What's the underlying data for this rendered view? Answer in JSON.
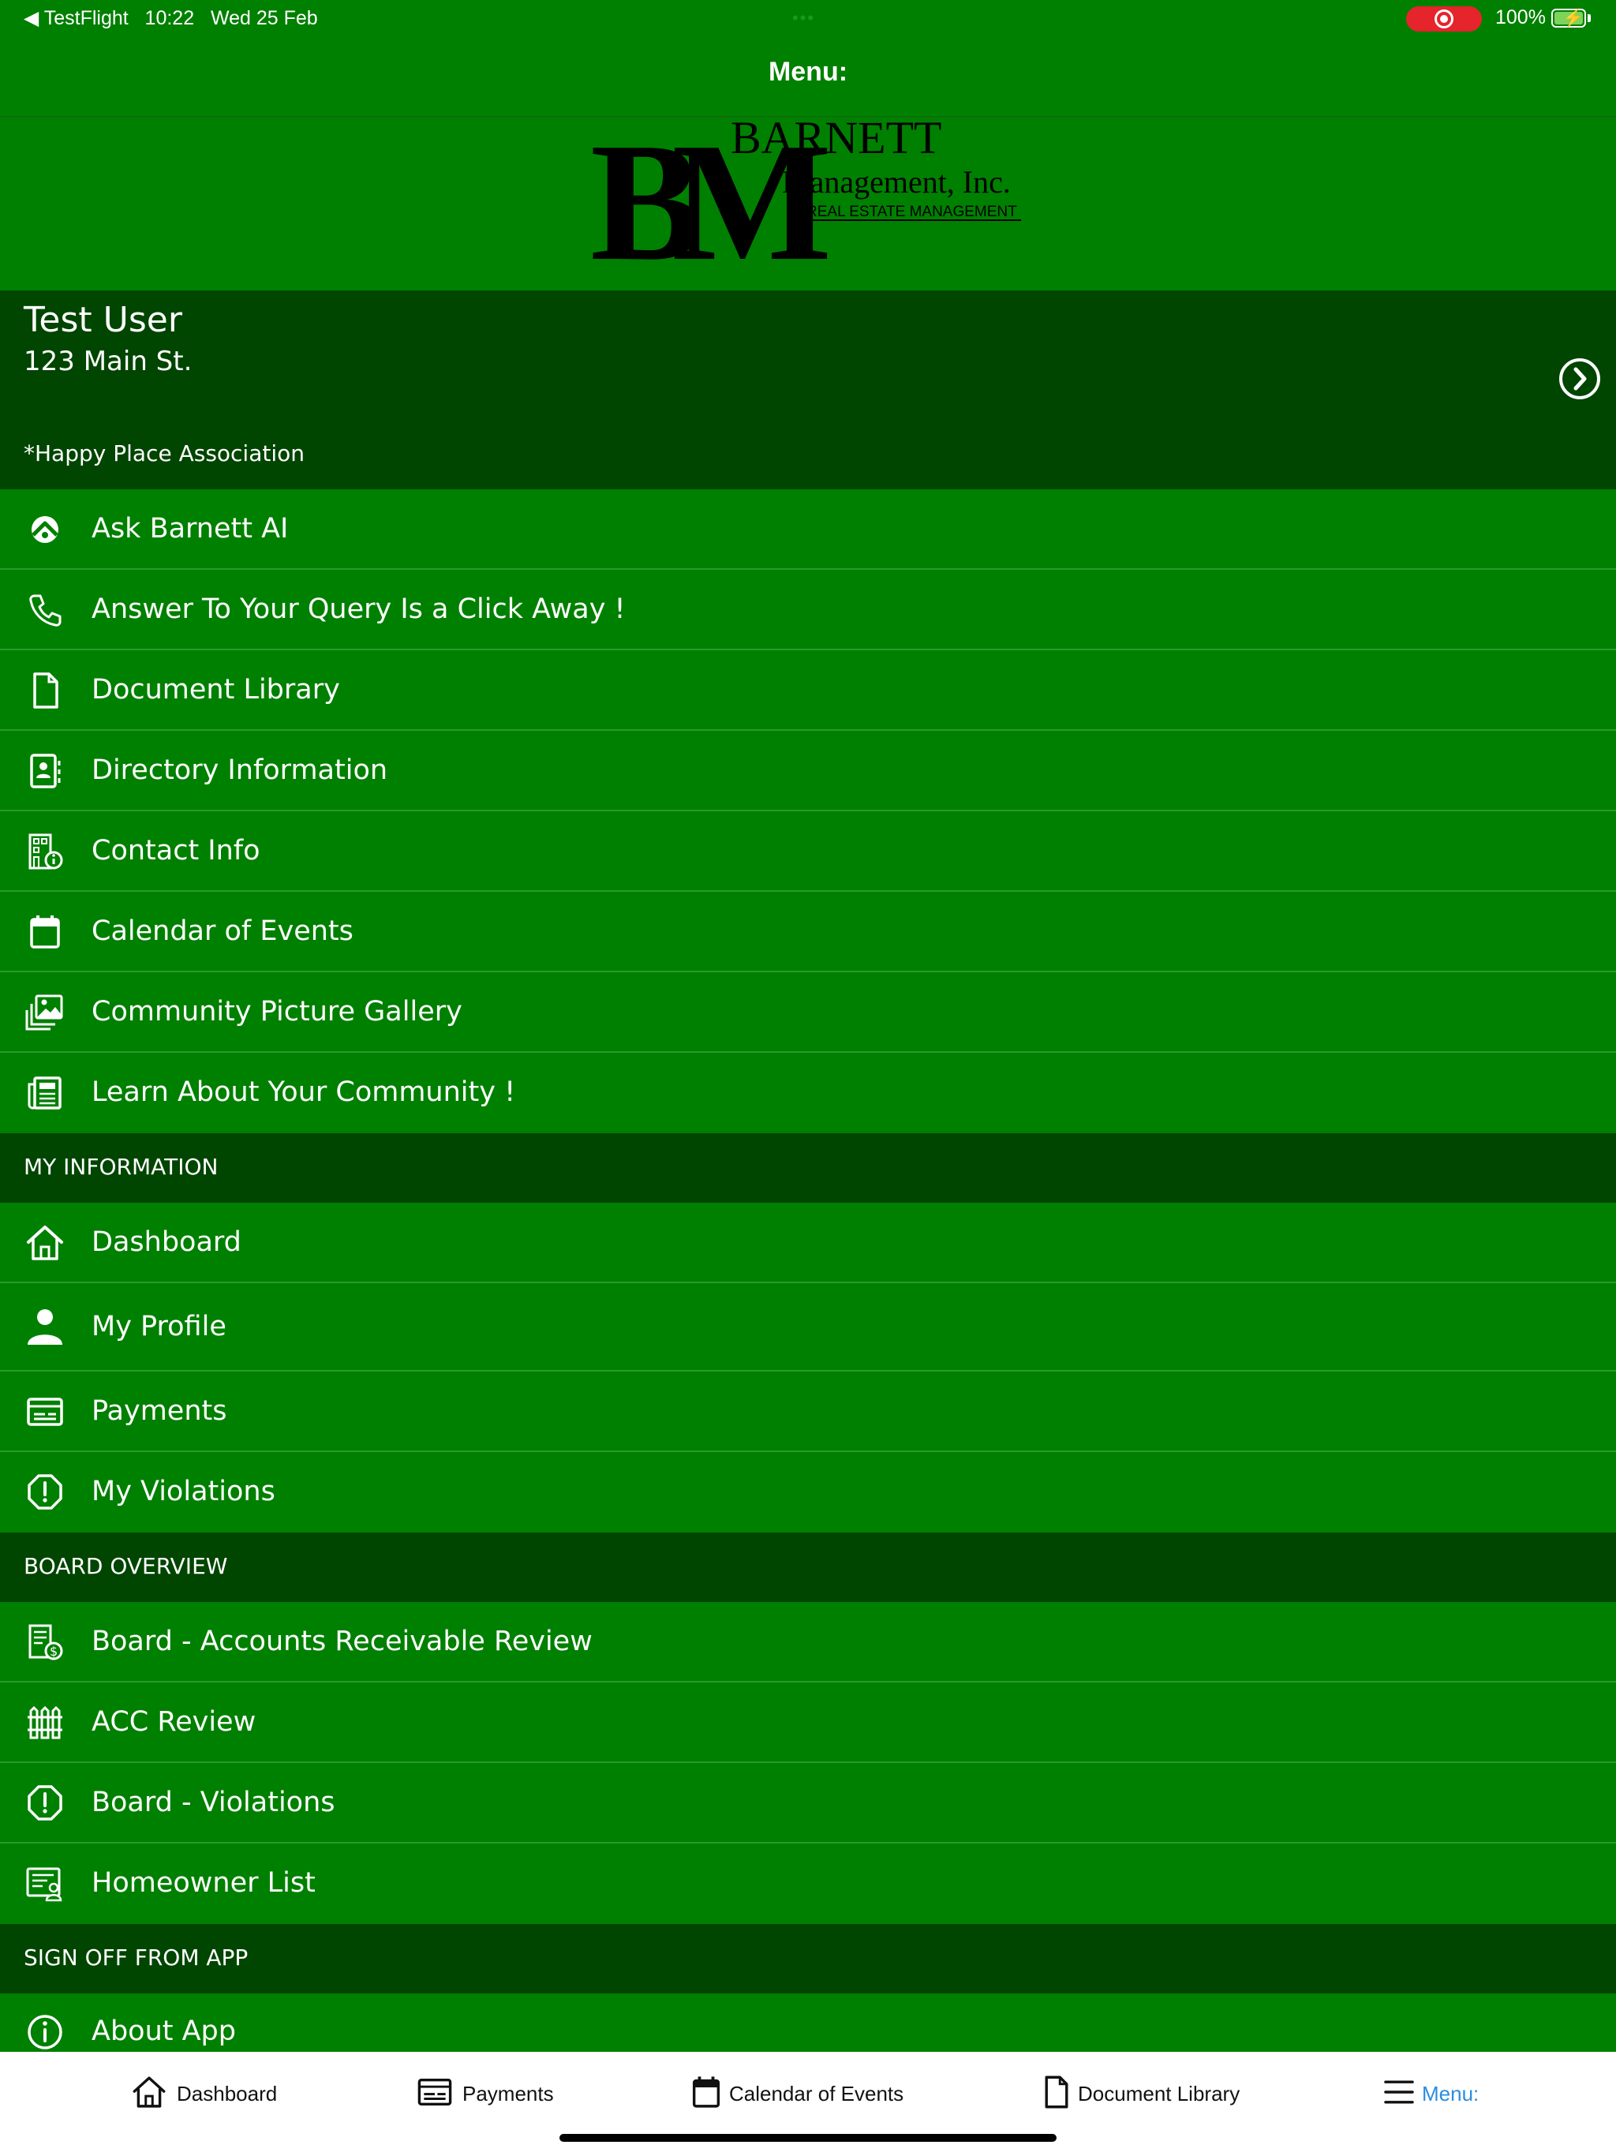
{
  "status_bar": {
    "back_app": "◀ TestFlight",
    "time": "10:22",
    "date": "Wed 25 Feb",
    "battery": "100%"
  },
  "navbar": {
    "title": "Menu:"
  },
  "logo": {
    "monogram": "BM",
    "company_line1": "BARNETT",
    "company_line2": "Management, Inc.",
    "tagline": "REAL ESTATE MANAGEMENT"
  },
  "user": {
    "name": "Test User",
    "address": "123 Main St."
  },
  "sections": {
    "association": "*Happy Place Association",
    "my_information": "MY INFORMATION",
    "board_overview": "BOARD OVERVIEW",
    "sign_off": "SIGN OFF FROM APP"
  },
  "association_items": [
    {
      "label": "Ask Barnett AI",
      "icon": "ai-icon"
    },
    {
      "label": "Answer To Your Query Is a Click Away !",
      "icon": "phone-icon"
    },
    {
      "label": "Document Library",
      "icon": "document-icon"
    },
    {
      "label": "Directory Information",
      "icon": "contact-card-icon"
    },
    {
      "label": "Contact Info",
      "icon": "building-info-icon"
    },
    {
      "label": "Calendar of Events",
      "icon": "calendar-icon"
    },
    {
      "label": "Community Picture Gallery",
      "icon": "gallery-icon"
    },
    {
      "label": "Learn About Your Community !",
      "icon": "newspaper-icon"
    }
  ],
  "my_information_items": [
    {
      "label": "Dashboard",
      "icon": "home-icon"
    },
    {
      "label": "My Profile",
      "icon": "person-icon"
    },
    {
      "label": "Payments",
      "icon": "payment-card-icon"
    },
    {
      "label": "My Violations",
      "icon": "alert-icon"
    }
  ],
  "board_items": [
    {
      "label": "Board - Accounts Receivable Review",
      "icon": "receivable-icon"
    },
    {
      "label": "ACC Review",
      "icon": "fence-icon"
    },
    {
      "label": "Board - Violations",
      "icon": "alert-icon"
    },
    {
      "label": "Homeowner List",
      "icon": "homeowner-list-icon"
    }
  ],
  "sign_off_items": [
    {
      "label": "About App",
      "icon": "info-icon"
    }
  ],
  "tabbar": {
    "dashboard": "Dashboard",
    "payments": "Payments",
    "calendar": "Calendar of Events",
    "documents": "Document Library",
    "menu": "Menu:"
  },
  "colors": {
    "primary_green": "#008000",
    "dark_green": "#004500",
    "active_tab": "#2b8de0",
    "record_pill": "#e5242b"
  }
}
